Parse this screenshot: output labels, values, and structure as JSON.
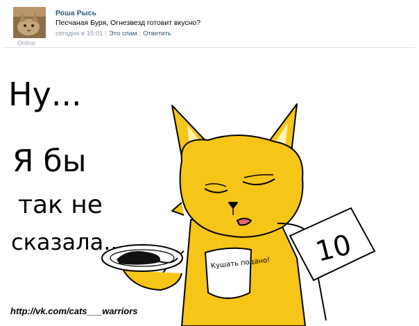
{
  "post": {
    "author": "Роша Рысь",
    "online_status": "Online",
    "text": "Песчаная Буря, Огнезвезд готовит вкусно?",
    "timestamp": "сегодня в 15:01",
    "spam_label": "Это спам",
    "reply_label": "Ответить"
  },
  "meme": {
    "lines": [
      "Ну...",
      "Я бы",
      "так не",
      "сказала..."
    ],
    "bib_text": "Кушать подано!",
    "sign_text": "10",
    "watermark": "http://vk.com/cats___warriors"
  },
  "colors": {
    "cat_orange": "#f5c518",
    "link_blue": "#2b587a",
    "meta_gray": "#8a97a5"
  }
}
